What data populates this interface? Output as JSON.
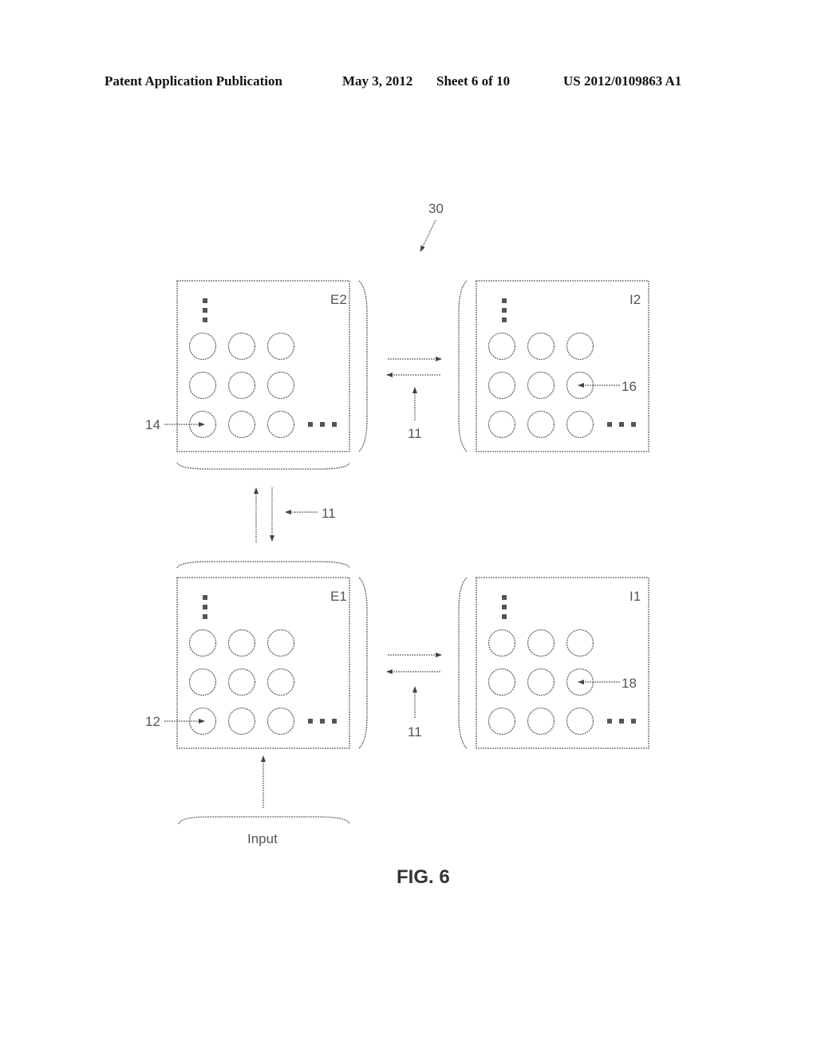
{
  "header": {
    "publication": "Patent Application Publication",
    "date": "May 3, 2012",
    "sheet": "Sheet 6 of 10",
    "number": "US 2012/0109863 A1"
  },
  "figure": {
    "caption": "FIG. 6",
    "reference": "30",
    "input_label": "Input",
    "connection_label": "11",
    "layers": [
      {
        "id": "E2",
        "label": "E2",
        "callout": "14"
      },
      {
        "id": "I2",
        "label": "I2",
        "callout": "16"
      },
      {
        "id": "E1",
        "label": "E1",
        "callout": "12"
      },
      {
        "id": "I1",
        "label": "I1",
        "callout": "18"
      }
    ],
    "grid": {
      "rows": 3,
      "cols": 3
    },
    "ellipsis": "..."
  }
}
